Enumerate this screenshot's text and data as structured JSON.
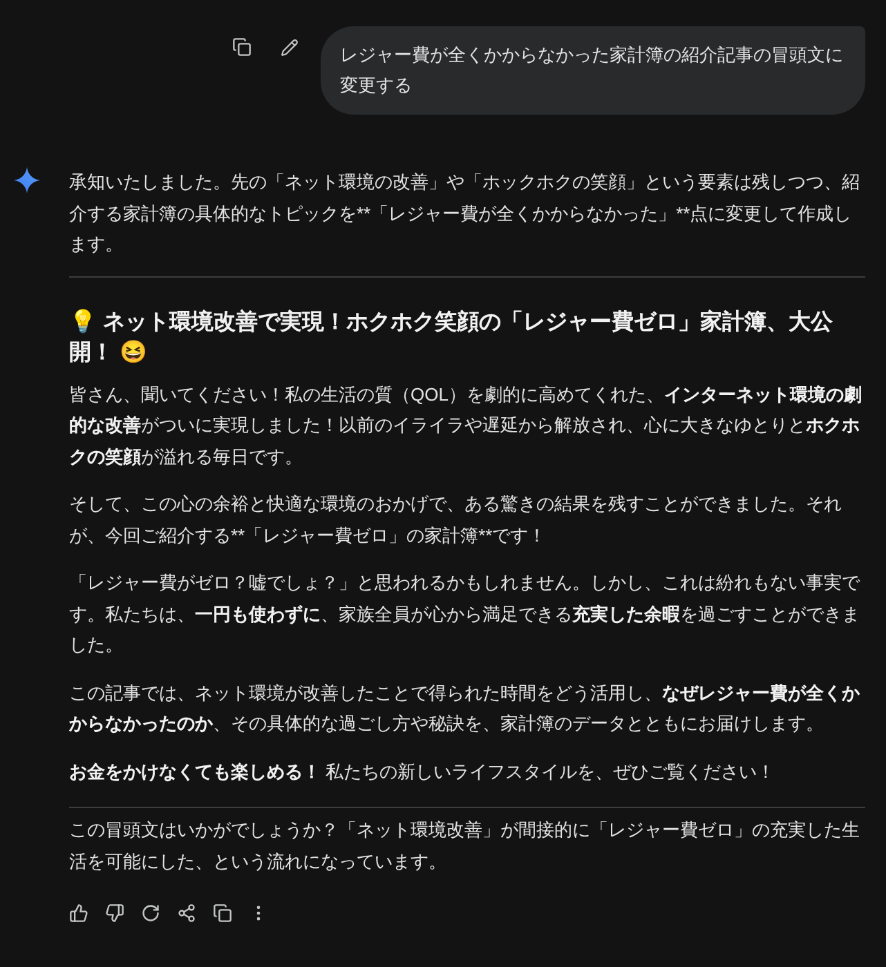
{
  "user_message": {
    "text": "レジャー費が全くかからなかった家計簿の紹介記事の冒頭文に変更する"
  },
  "response": {
    "intro": "承知いたしました。先の「ネット環境の改善」や「ホックホクの笑顔」という要素は残しつつ、紹介する家計簿の具体的なトピックを**「レジャー費が全くかからなかった」**点に変更して作成します。",
    "heading": "💡 ネット環境改善で実現！ホクホク笑顔の「レジャー費ゼロ」家計簿、大公開！ 😆",
    "paragraphs": [
      {
        "segments": [
          {
            "text": "皆さん、聞いてください！私の生活の質（QOL）を劇的に高めてくれた、",
            "bold": false
          },
          {
            "text": "インターネット環境の劇的な改善",
            "bold": true
          },
          {
            "text": "がついに実現しました！以前のイライラや遅延から解放され、心に大きなゆとりと",
            "bold": false
          },
          {
            "text": "ホクホクの笑顔",
            "bold": true
          },
          {
            "text": "が溢れる毎日です。",
            "bold": false
          }
        ]
      },
      {
        "segments": [
          {
            "text": "そして、この心の余裕と快適な環境のおかげで、ある驚きの結果を残すことができました。それが、今回ご紹介する**「レジャー費ゼロ」の家計簿**です！",
            "bold": false
          }
        ]
      },
      {
        "segments": [
          {
            "text": "「レジャー費がゼロ？嘘でしょ？」と思われるかもしれません。しかし、これは紛れもない事実です。私たちは、",
            "bold": false
          },
          {
            "text": "一円も使わずに",
            "bold": true
          },
          {
            "text": "、家族全員が心から満足できる",
            "bold": false
          },
          {
            "text": "充実した余暇",
            "bold": true
          },
          {
            "text": "を過ごすことができました。",
            "bold": false
          }
        ]
      },
      {
        "segments": [
          {
            "text": "この記事では、ネット環境が改善したことで得られた時間をどう活用し、",
            "bold": false
          },
          {
            "text": "なぜレジャー費が全くかからなかったのか",
            "bold": true
          },
          {
            "text": "、その具体的な過ごし方や秘訣を、家計簿のデータとともにお届けします。",
            "bold": false
          }
        ]
      },
      {
        "segments": [
          {
            "text": "お金をかけなくても楽しめる！",
            "bold": true
          },
          {
            "text": " 私たちの新しいライフスタイルを、ぜひご覧ください！",
            "bold": false
          }
        ]
      }
    ],
    "closing": "この冒頭文はいかがでしょうか？「ネット環境改善」が間接的に「レジャー費ゼロ」の充実した生活を可能にした、という流れになっています。"
  }
}
